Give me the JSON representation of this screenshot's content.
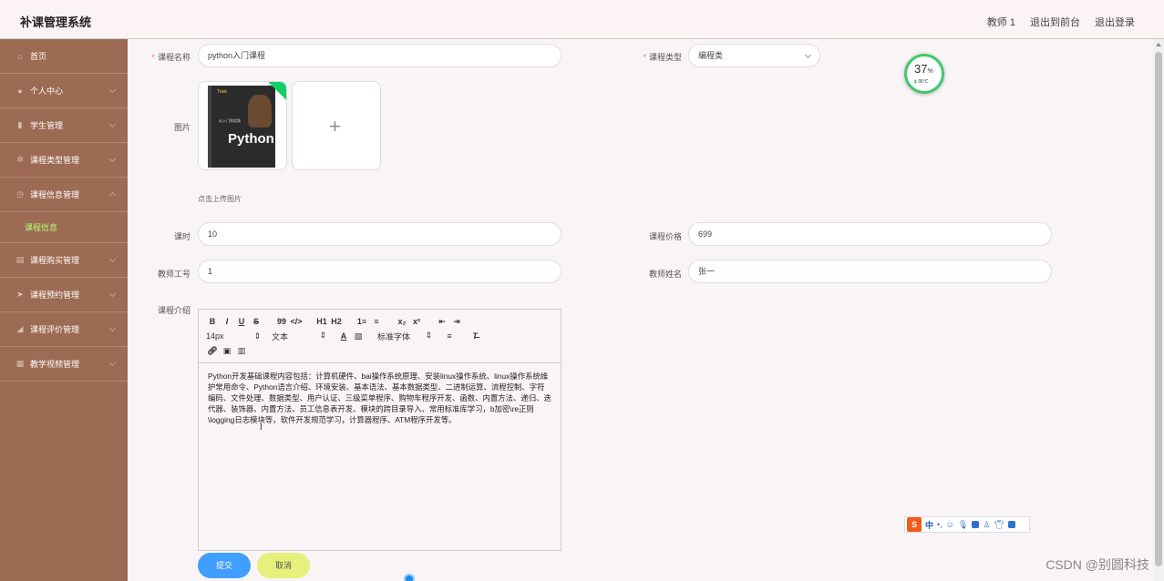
{
  "header": {
    "title": "补课管理系统",
    "user": "教师 1",
    "back_front": "退出到前台",
    "logout": "退出登录"
  },
  "sidebar": {
    "items": [
      {
        "label": "首页",
        "icon": "home-icon"
      },
      {
        "label": "个人中心",
        "icon": "user-icon"
      },
      {
        "label": "学生管理",
        "icon": "mic-icon"
      },
      {
        "label": "课程类型管理",
        "icon": "settings-icon"
      },
      {
        "label": "课程信息管理",
        "icon": "clock-icon"
      },
      {
        "label": "课程购买管理",
        "icon": "card-icon"
      },
      {
        "label": "课程预约管理",
        "icon": "send-icon"
      },
      {
        "label": "课程评价管理",
        "icon": "paper-plane-icon"
      },
      {
        "label": "教学视频管理",
        "icon": "grid-icon"
      }
    ],
    "active_sub": "课程信息"
  },
  "form": {
    "course_name_label": "课程名称",
    "course_name_value": "python入门课程",
    "course_type_label": "课程类型",
    "course_type_value": "编程类",
    "image_label": "图片",
    "upload_hint": "点击上传图片",
    "book_title": "Python",
    "book_top": "Train",
    "book_sub": "从入门到实践",
    "hours_label": "课时",
    "hours_value": "10",
    "price_label": "课程价格",
    "price_value": "699",
    "teacher_id_label": "教师工号",
    "teacher_id_value": "1",
    "teacher_name_label": "教师姓名",
    "teacher_name_value": "张一",
    "intro_label": "课程介绍"
  },
  "editor": {
    "row1": [
      "B",
      "I",
      "U",
      "S",
      "99",
      "</>",
      "H1",
      "H2",
      "1≡",
      "≡",
      "x₂",
      "x²",
      "⇤",
      "⇥"
    ],
    "size_value": "14px",
    "text_value": "文本",
    "font_value": "标准字体",
    "content": "Python开发基础课程内容包括：计算机硬件、bai操作系统原理、安装linux操作系统、linux操作系统维护常用命令、Python语言介绍、环境安装、基本语法、基本数据类型、二进制运算、流程控制、字符编码、文件处理、数据类型、用户认证、三级菜单程序、购物车程序开发、函数、内置方法、递归、迭代器、装饰器、内置方法、员工信息表开发、模块的跨目录导入、常用标准库学习，b加密\\re正则\\logging日志模块等，软件开发规范学习，计算器程序、ATM程序开发等。"
  },
  "buttons": {
    "submit": "提交",
    "cancel": "取消"
  },
  "gauge": {
    "percent": "37",
    "unit": "%",
    "temp": "36℃"
  },
  "ime": {
    "logo": "S",
    "lang": "中"
  },
  "watermark": "CSDN @别圆科技",
  "colors": {
    "sidebar": "#9d6a53",
    "active": "#b5ff79",
    "submit": "#409eff",
    "cancel": "#e6f07a"
  }
}
